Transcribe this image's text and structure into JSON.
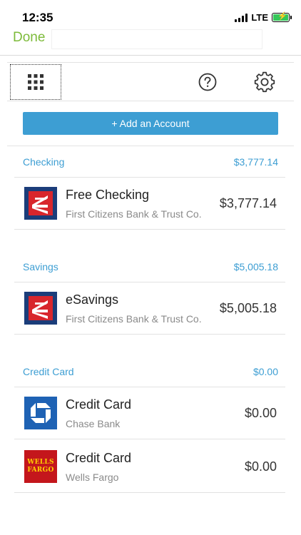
{
  "status": {
    "time": "12:35",
    "network": "LTE"
  },
  "nav": {
    "done_label": "Done"
  },
  "toolbar": {
    "grid_icon": "grid-icon",
    "help_icon": "help-icon",
    "settings_icon": "gear-icon"
  },
  "add_account_label": "+ Add an Account",
  "colors": {
    "accent": "#3d9ed3",
    "done": "#7dbb3a",
    "first_citizens": "#1b3d7a",
    "chase": "#1e62b4",
    "wells_fargo": "#c4161c"
  },
  "sections": [
    {
      "name": "Checking",
      "total": "$3,777.14",
      "accounts": [
        {
          "name": "Free Checking",
          "institution": "First Citizens Bank & Trust Co.",
          "balance": "$3,777.14",
          "logo": "first-citizens-logo"
        }
      ]
    },
    {
      "name": "Savings",
      "total": "$5,005.18",
      "accounts": [
        {
          "name": "eSavings",
          "institution": "First Citizens Bank & Trust Co.",
          "balance": "$5,005.18",
          "logo": "first-citizens-logo"
        }
      ]
    },
    {
      "name": "Credit Card",
      "total": "$0.00",
      "accounts": [
        {
          "name": "Credit Card",
          "institution": "Chase Bank",
          "balance": "$0.00",
          "logo": "chase-logo"
        },
        {
          "name": "Credit Card",
          "institution": "Wells Fargo",
          "balance": "$0.00",
          "logo": "wells-fargo-logo",
          "logo_text": [
            "WELLS",
            "FARGO"
          ]
        }
      ]
    }
  ]
}
